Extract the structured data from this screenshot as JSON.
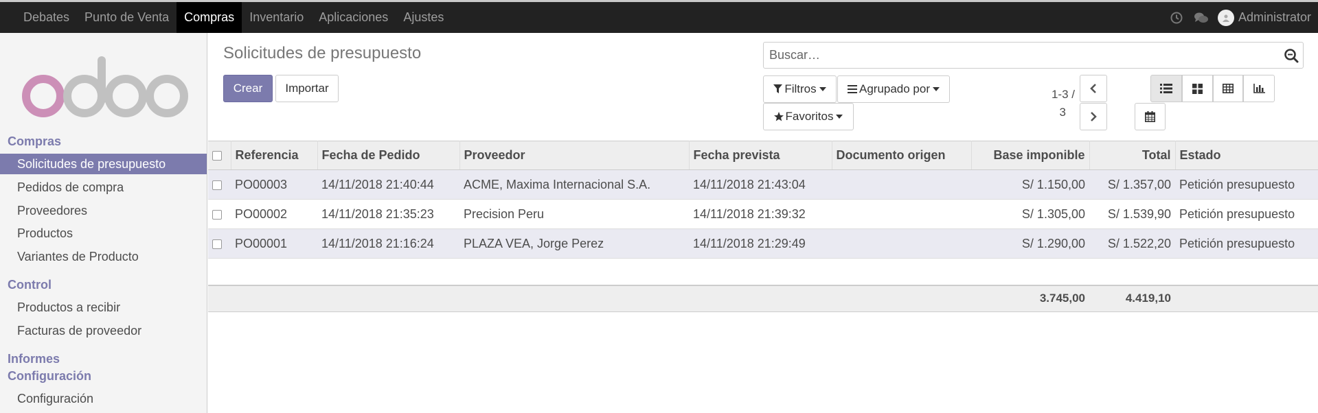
{
  "topbar": {
    "menu": [
      "Debates",
      "Punto de Venta",
      "Compras",
      "Inventario",
      "Aplicaciones",
      "Ajustes"
    ],
    "user": "Administrator"
  },
  "sidebar": {
    "sections": [
      {
        "title": "Compras",
        "items": [
          "Solicitudes de presupuesto",
          "Pedidos de compra",
          "Proveedores",
          "Productos",
          "Variantes de Producto"
        ]
      },
      {
        "title": "Control",
        "items": [
          "Productos a recibir",
          "Facturas de proveedor"
        ]
      },
      {
        "title": "Informes",
        "items": []
      },
      {
        "title": "Configuración",
        "items": [
          "Configuración"
        ]
      }
    ]
  },
  "page": {
    "title": "Solicitudes de presupuesto"
  },
  "buttons": {
    "create": "Crear",
    "import": "Importar"
  },
  "search": {
    "placeholder": "Buscar…"
  },
  "filters": {
    "filters": "Filtros",
    "group_by": "Agrupado por",
    "favorites": "Favoritos"
  },
  "pager": {
    "range": "1-3 /",
    "total": "3"
  },
  "table": {
    "headers": [
      "Referencia",
      "Fecha de Pedido",
      "Proveedor",
      "Fecha prevista",
      "Documento origen",
      "Base imponible",
      "Total",
      "Estado"
    ],
    "rows": [
      [
        "PO00003",
        "14/11/2018 21:40:44",
        "ACME, Maxima Internacional S.A.",
        "14/11/2018 21:43:04",
        "",
        "S/ 1.150,00",
        "S/ 1.357,00",
        "Petición presupuesto"
      ],
      [
        "PO00002",
        "14/11/2018 21:35:23",
        "Precision Peru",
        "14/11/2018 21:39:32",
        "",
        "S/ 1.305,00",
        "S/ 1.539,90",
        "Petición presupuesto"
      ],
      [
        "PO00001",
        "14/11/2018 21:16:24",
        "PLAZA VEA, Jorge Perez",
        "14/11/2018 21:29:49",
        "",
        "S/ 1.290,00",
        "S/ 1.522,20",
        "Petición presupuesto"
      ]
    ],
    "totals": {
      "base": "3.745,00",
      "total": "4.419,10"
    }
  },
  "colors": {
    "accent": "#7c7bad",
    "topbar": "#222222"
  },
  "icons": [
    "clock-icon",
    "chat-icon",
    "search-icon",
    "filter-icon",
    "bars-icon",
    "star-icon",
    "caret-down-icon",
    "chevron-left-icon",
    "chevron-right-icon",
    "list-view-icon",
    "kanban-view-icon",
    "pivot-view-icon",
    "graph-view-icon",
    "calendar-view-icon"
  ]
}
